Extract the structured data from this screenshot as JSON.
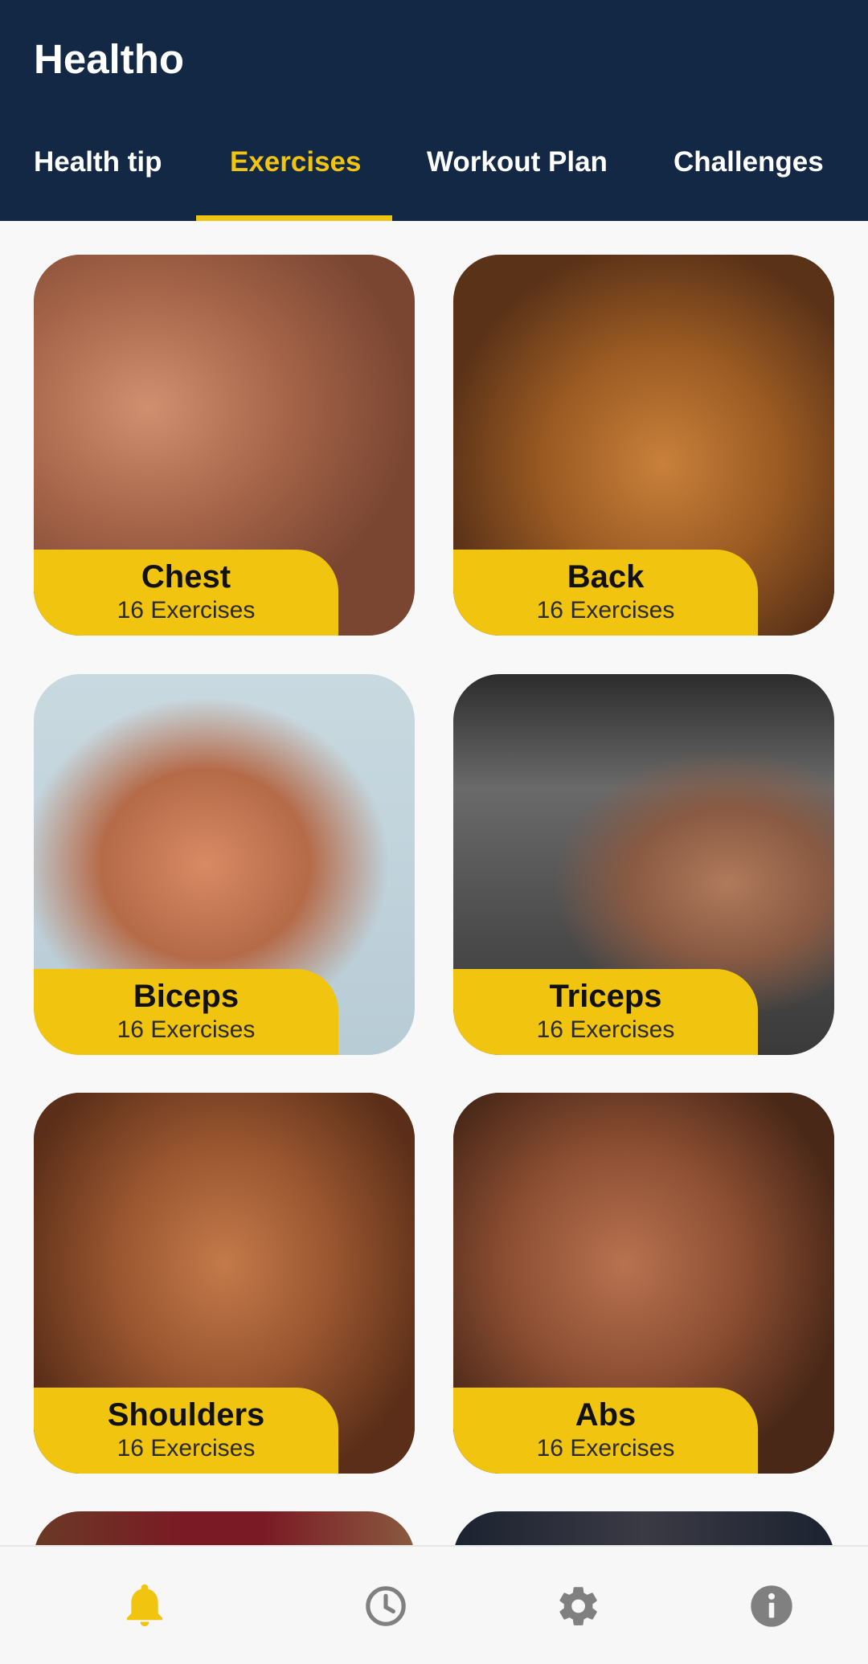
{
  "app": {
    "title": "Healtho"
  },
  "tabs": [
    {
      "label": "Health tip"
    },
    {
      "label": "Exercises",
      "active": true
    },
    {
      "label": "Workout Plan"
    },
    {
      "label": "Challenges"
    }
  ],
  "cards": [
    {
      "name": "Chest",
      "count": "16 Exercises"
    },
    {
      "name": "Back",
      "count": "16 Exercises"
    },
    {
      "name": "Biceps",
      "count": "16 Exercises"
    },
    {
      "name": "Triceps",
      "count": "16 Exercises"
    },
    {
      "name": "Shoulders",
      "count": "16 Exercises"
    },
    {
      "name": "Abs",
      "count": "16 Exercises"
    }
  ],
  "bottom_nav": [
    {
      "icon": "bell-icon",
      "active": true
    },
    {
      "icon": "clock-icon"
    },
    {
      "icon": "gear-icon"
    },
    {
      "icon": "info-icon"
    }
  ],
  "colors": {
    "header": "#132845",
    "accent": "#f1c40f",
    "background": "#f8f8f8",
    "nav_icon": "#808080"
  }
}
